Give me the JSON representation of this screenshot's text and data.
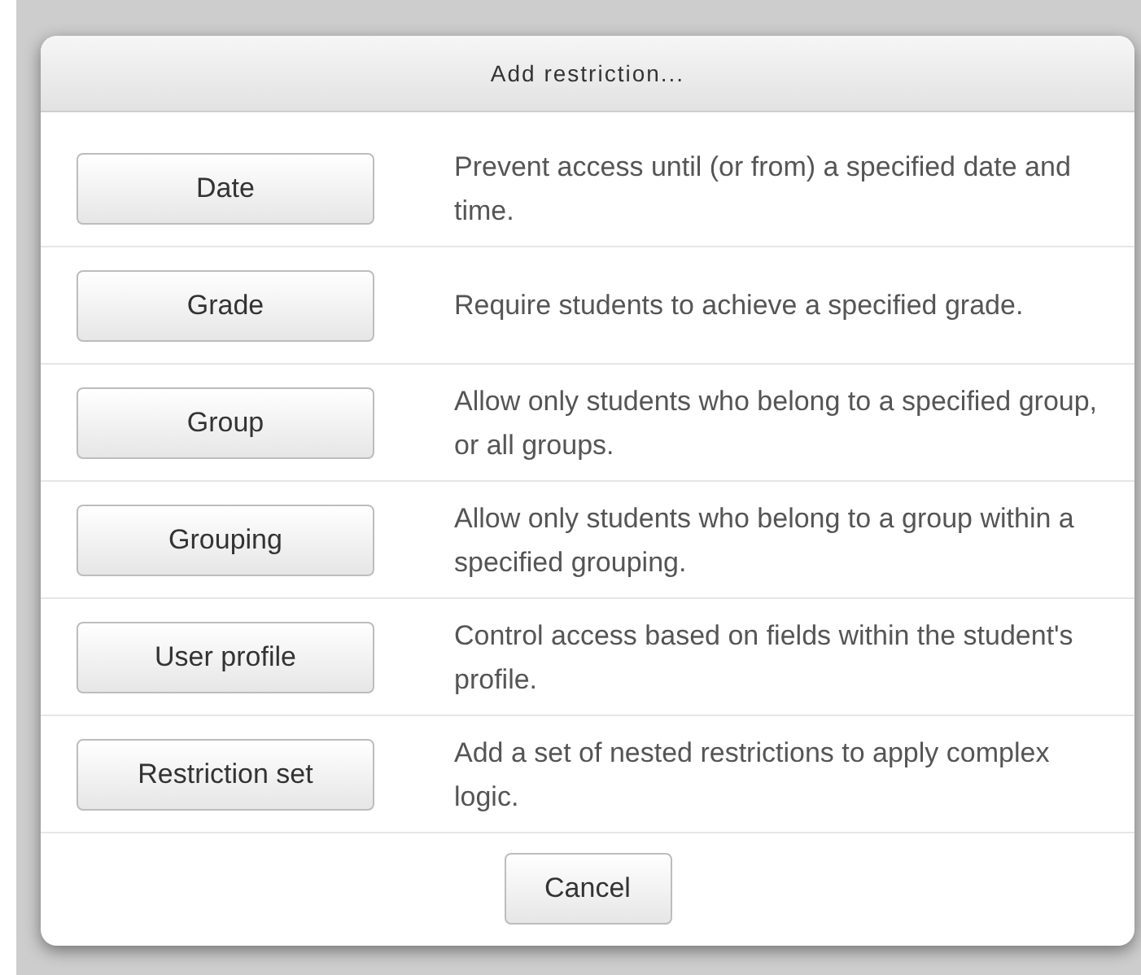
{
  "dialog": {
    "title": "Add restriction...",
    "options": [
      {
        "button": "Date",
        "description": "Prevent access until (or from) a specified date and time."
      },
      {
        "button": "Grade",
        "description": "Require students to achieve a specified grade."
      },
      {
        "button": "Group",
        "description": "Allow only students who belong to a specified group, or all groups."
      },
      {
        "button": "Grouping",
        "description": "Allow only students who belong to a group within a specified grouping."
      },
      {
        "button": "User profile",
        "description": "Control access based on fields within the student's profile."
      },
      {
        "button": "Restriction set",
        "description": "Add a set of nested restrictions to apply complex logic."
      }
    ],
    "cancel": "Cancel"
  }
}
